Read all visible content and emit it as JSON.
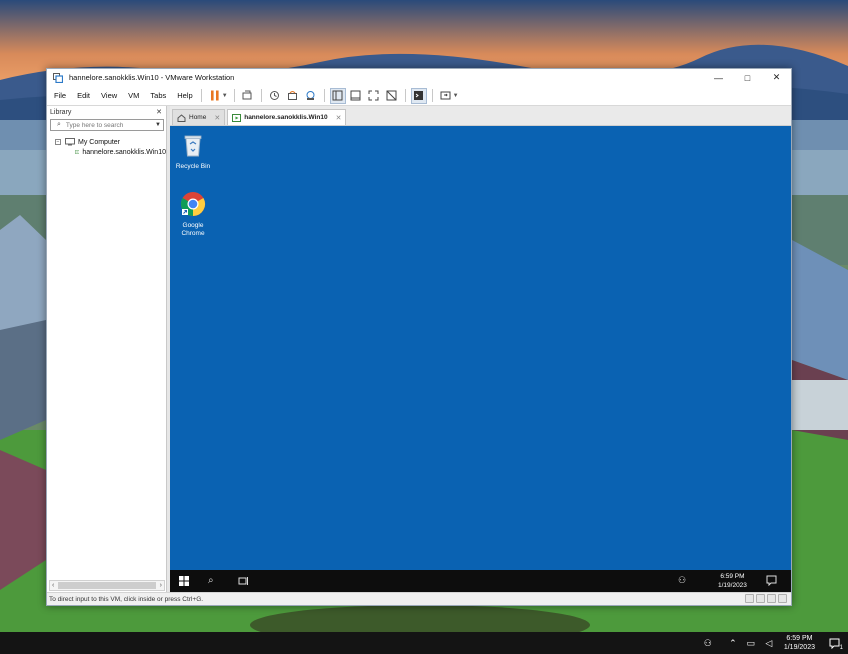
{
  "window": {
    "title": "hannelore.sanokklis.Win10 - VMware Workstation",
    "minimize_label": "—",
    "maximize_label": "□",
    "close_label": "✕"
  },
  "menu": [
    "File",
    "Edit",
    "View",
    "VM",
    "Tabs",
    "Help"
  ],
  "library": {
    "title": "Library",
    "close_label": "✕",
    "search_placeholder": "Type here to search",
    "tree": {
      "root_label": "My Computer",
      "vm_label": "hannelore.sanokklis.Win10"
    }
  },
  "tabs": [
    {
      "label": "Home",
      "close": "✕"
    },
    {
      "label": "hannelore.sanokklis.Win10",
      "close": "✕"
    }
  ],
  "guest": {
    "desktop_icons": [
      {
        "label": "Recycle Bin"
      },
      {
        "label": "Google Chrome"
      }
    ],
    "clock_time": "6:59 PM",
    "clock_date": "1/19/2023",
    "background_color": "#0a62b2"
  },
  "statusbar": {
    "text": "To direct input to this VM, click inside or press Ctrl+G."
  },
  "host": {
    "clock_time": "6:59 PM",
    "clock_date": "1/19/2023",
    "notification_count": "1"
  },
  "icons": {
    "toolbar": [
      "pause-icon",
      "send-ctrl-alt-del-icon",
      "snapshot-icon",
      "revert-snapshot-icon",
      "snapshot-manager-icon",
      "library-view-icon",
      "thumbnail-view-icon",
      "fullscreen-icon",
      "unity-icon",
      "console-icon",
      "stretch-icon"
    ]
  },
  "colors": {
    "pause_accent": "#e87722",
    "guest_desktop": "#0a62b2",
    "taskbar": "#0d0d0d"
  }
}
